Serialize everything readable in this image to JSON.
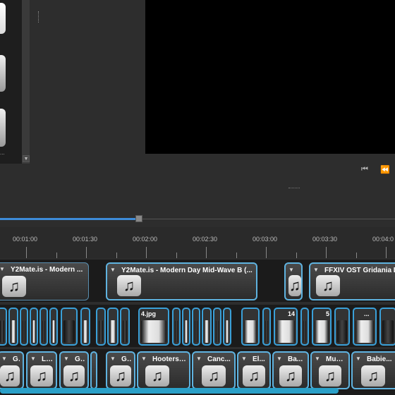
{
  "files_panel": {
    "ellipsis": "...",
    "scroll_down_icon": "arrow-down"
  },
  "player": {
    "rewind_icon": "skip-backward",
    "back_icon": "rewind"
  },
  "colors": {
    "accent": "#3d8bd8",
    "clip_border": "#5fb3e0",
    "preview_bg": "#000000"
  },
  "ruler": {
    "ticks": [
      {
        "label": "00:01:00"
      },
      {
        "label": "00:01:30"
      },
      {
        "label": "00:02:00"
      },
      {
        "label": "00:02:30"
      },
      {
        "label": "00:03:00"
      },
      {
        "label": "00:03:30"
      },
      {
        "label": "00:04:0"
      }
    ]
  },
  "tracks": {
    "track1": [
      {
        "title": "Y2Mate.is - Modern ...",
        "icon": "music-note"
      },
      {
        "title": "Y2Mate.is - Modern Day Mid-Wave B (...",
        "icon": "music-note"
      },
      {
        "title": "",
        "icon": "music-note"
      },
      {
        "title": "FFXIV OST Gridania D",
        "icon": "music-note"
      }
    ],
    "track2_labels": {
      "a": "4.jpg",
      "b": "14",
      "c": "5",
      "d": "..."
    },
    "track3": [
      {
        "title": "G...",
        "icon": "music-note"
      },
      {
        "title": "Lu...",
        "icon": "music-note"
      },
      {
        "title": "G...",
        "icon": "music-note"
      },
      {
        "title": "G...",
        "icon": "music-note"
      },
      {
        "title": "Hooters....",
        "icon": "music-note"
      },
      {
        "title": "Canc...",
        "icon": "music-note"
      },
      {
        "title": "El...",
        "icon": "music-note"
      },
      {
        "title": "Ba...",
        "icon": "music-note"
      },
      {
        "title": "Muk...",
        "icon": "music-note"
      },
      {
        "title": "Babie...",
        "icon": "music-note"
      }
    ]
  }
}
